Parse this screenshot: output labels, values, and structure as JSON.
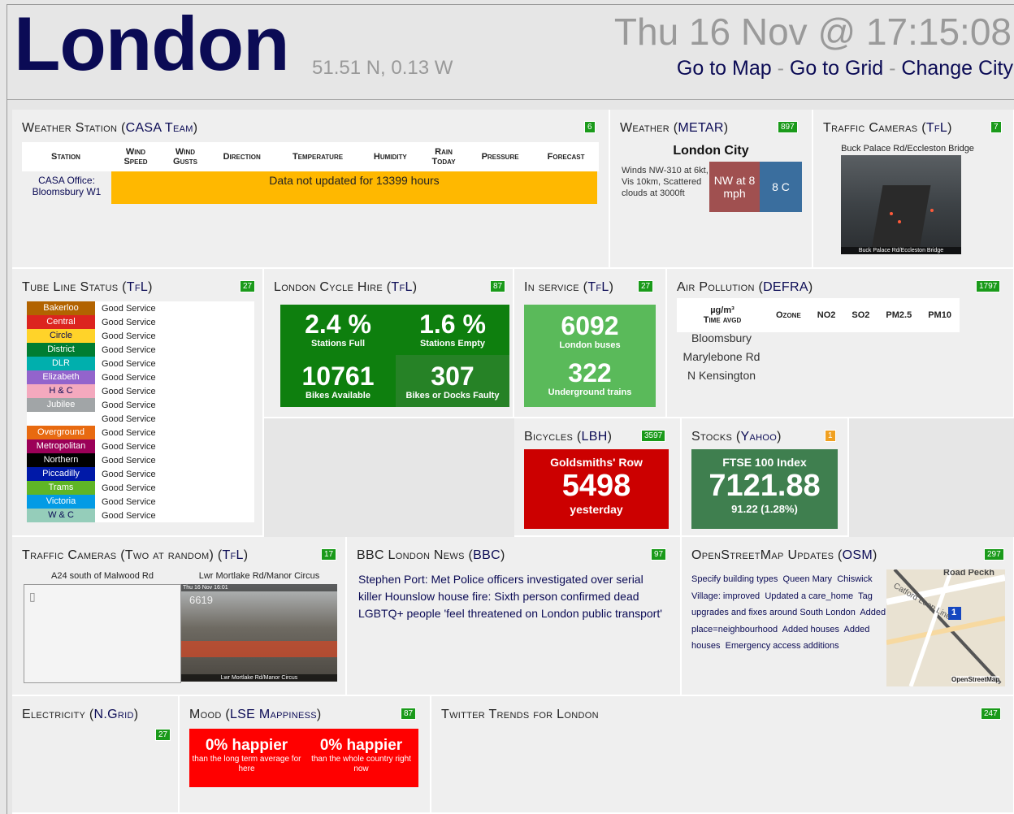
{
  "header": {
    "city": "London",
    "coords": "51.51 N, 0.13 W",
    "datetime": "Thu 16 Nov @ 17:15:08",
    "links": [
      "Go to Map",
      "Go to Grid",
      "Change City"
    ],
    "sep": " - "
  },
  "weather_station": {
    "title": "Weather Station",
    "source": "CASA Team",
    "badge": "6",
    "columns": [
      "Station",
      "Wind Speed",
      "Wind Gusts",
      "Direction",
      "Temperature",
      "Humidity",
      "Rain Today",
      "Pressure",
      "Forecast"
    ],
    "station": "CASA Office: Bloomsbury W1",
    "message": "Data not updated for 13399 hours"
  },
  "metar": {
    "title": "Weather",
    "source": "METAR",
    "badge": "897",
    "name": "London City",
    "text": "Winds NW-310 at 6kt, Vis 10km, Scattered clouds at 3000ft",
    "wind": "NW at 8 mph",
    "temp": "8 C"
  },
  "traffic_cam": {
    "title": "Traffic Cameras",
    "source": "TfL",
    "badge": "7",
    "caption": "Buck Palace Rd/Eccleston Bridge",
    "foot": "Buck Palace Rd/Eccleston Bridge"
  },
  "tube": {
    "title": "Tube Line Status",
    "source": "TfL",
    "badge": "27",
    "lines": [
      {
        "name": "Bakerloo",
        "status": "Good Service",
        "bg": "#b26300",
        "fg": "#ffffff"
      },
      {
        "name": "Central",
        "status": "Good Service",
        "bg": "#dc241f",
        "fg": "#ffffff"
      },
      {
        "name": "Circle",
        "status": "Good Service",
        "bg": "#ffd329",
        "fg": "#0b0b55"
      },
      {
        "name": "District",
        "status": "Good Service",
        "bg": "#007d32",
        "fg": "#ffffff"
      },
      {
        "name": "DLR",
        "status": "Good Service",
        "bg": "#00afad",
        "fg": "#ffffff"
      },
      {
        "name": "Elizabeth",
        "status": "Good Service",
        "bg": "#9364cc",
        "fg": "#ffffff"
      },
      {
        "name": "H & C",
        "status": "Good Service",
        "bg": "#f4a9be",
        "fg": "#0b0b55"
      },
      {
        "name": "Jubilee",
        "status": "Good Service",
        "bg": "#a1a5a7",
        "fg": "#ffffff"
      },
      {
        "name": "",
        "status": "Good Service",
        "bg": "#ffffff",
        "fg": "#000000"
      },
      {
        "name": "Overground",
        "status": "Good Service",
        "bg": "#e86a10",
        "fg": "#ffffff"
      },
      {
        "name": "Metropolitan",
        "status": "Good Service",
        "bg": "#9b0058",
        "fg": "#ffffff"
      },
      {
        "name": "Northern",
        "status": "Good Service",
        "bg": "#000000",
        "fg": "#ffffff"
      },
      {
        "name": "Piccadilly",
        "status": "Good Service",
        "bg": "#0019a8",
        "fg": "#ffffff"
      },
      {
        "name": "Trams",
        "status": "Good Service",
        "bg": "#5fb526",
        "fg": "#ffffff"
      },
      {
        "name": "Victoria",
        "status": "Good Service",
        "bg": "#039be5",
        "fg": "#ffffff"
      },
      {
        "name": "W & C",
        "status": "Good Service",
        "bg": "#95cdba",
        "fg": "#0b0b55"
      }
    ]
  },
  "cycle": {
    "title": "London Cycle Hire",
    "source": "TfL",
    "badge": "87",
    "full_pct": "2.4 %",
    "full_label": "Stations Full",
    "empty_pct": "1.6 %",
    "empty_label": "Stations Empty",
    "bikes": "10761",
    "bikes_label": "Bikes Available",
    "faulty": "307",
    "faulty_label": "Bikes or Docks Faulty"
  },
  "in_service": {
    "title": "In service",
    "source": "TfL",
    "badge": "27",
    "buses": "6092",
    "buses_label": "London buses",
    "trains": "322",
    "trains_label": "Underground trains"
  },
  "air": {
    "title": "Air Pollution",
    "source": "DEFRA",
    "badge": "1797",
    "units": "µg/m³",
    "units_sub": "Time avgd",
    "cols": [
      "Ozone",
      "NO2",
      "SO2",
      "PM2.5",
      "PM10"
    ],
    "sites": [
      "Bloomsbury",
      "Marylebone Rd",
      "N Kensington"
    ]
  },
  "bicycles": {
    "title": "Bicycles",
    "source": "LBH",
    "badge": "3597",
    "place": "Goldsmiths' Row",
    "count": "5498",
    "when": "yesterday"
  },
  "stocks": {
    "title": "Stocks",
    "source": "Yahoo",
    "badge": "1",
    "index": "FTSE 100 Index",
    "value": "7121.88",
    "change": "91.22 (1.28%)"
  },
  "random_cams": {
    "title": "Traffic Cameras (Two at random)",
    "source": "TfL",
    "badge": "17",
    "cam1": "A24 south of Malwood Rd",
    "cam2": "Lwr Mortlake Rd/Manor Circus",
    "cam2_stamp": "Thu 16 Nov 16:01",
    "cam2_id": "6619",
    "cam2_foot": "Lwr Mortlake Rd/Manor Circus"
  },
  "news": {
    "title": "BBC London News",
    "source": "BBC",
    "badge": "97",
    "items": [
      "Stephen Port: Met Police officers investigated over serial killer",
      "Hounslow house fire: Sixth person confirmed dead",
      "LGBTQ+ people 'feel threatened on London public transport'"
    ]
  },
  "osm": {
    "title": "OpenStreetMap Updates",
    "source": "OSM",
    "badge": "297",
    "items": [
      "Specify building types",
      "Queen Mary",
      "Chiswick Village: improved",
      "Updated a care_home",
      "Tag upgrades and fixes around South London",
      "Added place=neighbourhood",
      "Added houses",
      "Added houses",
      "Emergency access additions"
    ],
    "map_road": "Road Peckh",
    "map_label": "Catford Loop Line",
    "map_marker": "1",
    "map_logo": "OpenStreetMap"
  },
  "electricity": {
    "title": "Electricity",
    "source": "N.Grid",
    "badge": "27"
  },
  "mood": {
    "title": "Mood",
    "source": "LSE Mappiness",
    "badge": "87",
    "left_pct": "0% happier",
    "left_desc": "than the long term average for here",
    "right_pct": "0% happier",
    "right_desc": "than the whole country right now"
  },
  "twitter": {
    "title": "Twitter Trends for London",
    "badge": "247"
  }
}
